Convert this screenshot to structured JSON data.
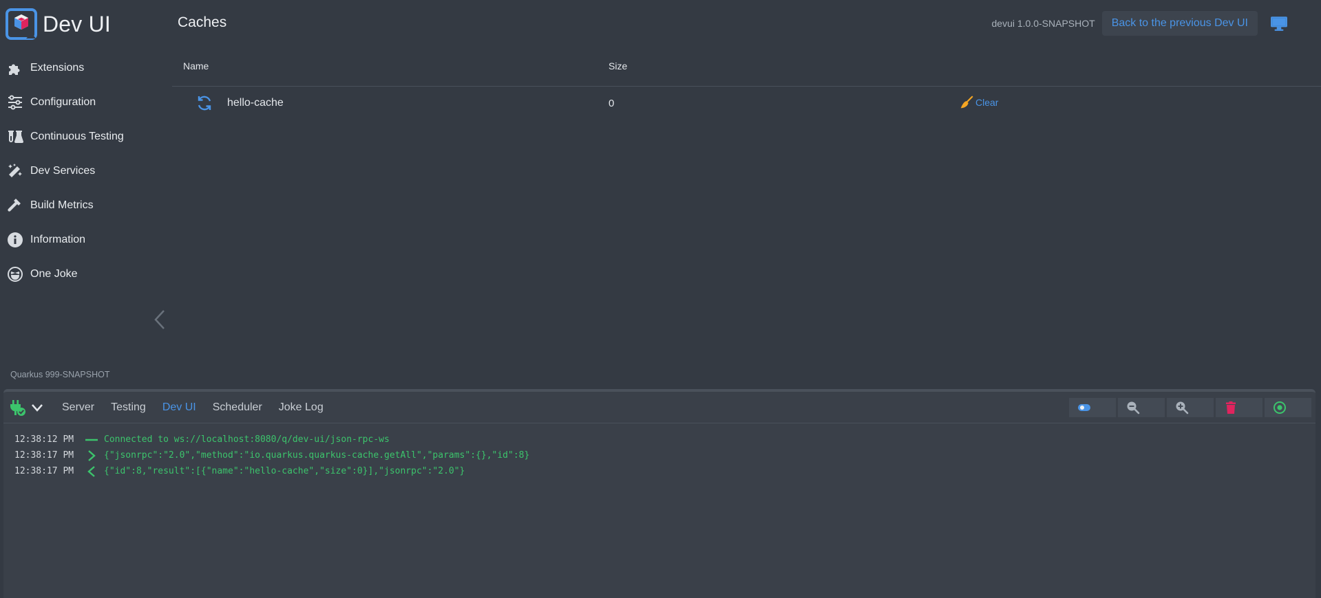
{
  "brand": {
    "title": "Dev UI"
  },
  "sidebar": {
    "items": [
      {
        "label": "Extensions",
        "icon": "puzzle-icon"
      },
      {
        "label": "Configuration",
        "icon": "sliders-icon"
      },
      {
        "label": "Continuous Testing",
        "icon": "flask-icon"
      },
      {
        "label": "Dev Services",
        "icon": "magic-wand-icon"
      },
      {
        "label": "Build Metrics",
        "icon": "hammer-icon"
      },
      {
        "label": "Information",
        "icon": "info-icon"
      },
      {
        "label": "One Joke",
        "icon": "laugh-icon"
      }
    ],
    "quarkus_version": "Quarkus 999-SNAPSHOT"
  },
  "header": {
    "title": "Caches",
    "devui_version": "devui 1.0.0-SNAPSHOT",
    "back_label": "Back to the previous Dev UI"
  },
  "table": {
    "columns": [
      "Name",
      "Size"
    ],
    "rows": [
      {
        "name": "hello-cache",
        "size": "0",
        "action": "Clear"
      }
    ]
  },
  "footer": {
    "tabs": [
      "Server",
      "Testing",
      "Dev UI",
      "Scheduler",
      "Joke Log"
    ],
    "active_tab": "Dev UI",
    "log": [
      {
        "time": "12:38:12 PM",
        "kind": "connected",
        "text": "Connected to ws://localhost:8080/q/dev-ui/json-rpc-ws"
      },
      {
        "time": "12:38:17 PM",
        "kind": "outgoing",
        "text": "{\"jsonrpc\":\"2.0\",\"method\":\"io.quarkus.quarkus-cache.getAll\",\"params\":{},\"id\":8}"
      },
      {
        "time": "12:38:17 PM",
        "kind": "incoming",
        "text": "{\"id\":8,\"result\":[{\"name\":\"hello-cache\",\"size\":0}],\"jsonrpc\":\"2.0\"}"
      }
    ]
  },
  "colors": {
    "accent": "#4a94e6",
    "log_green": "#3cc46c",
    "clear_orange": "#f5a623",
    "trash_red": "#e0245e"
  }
}
